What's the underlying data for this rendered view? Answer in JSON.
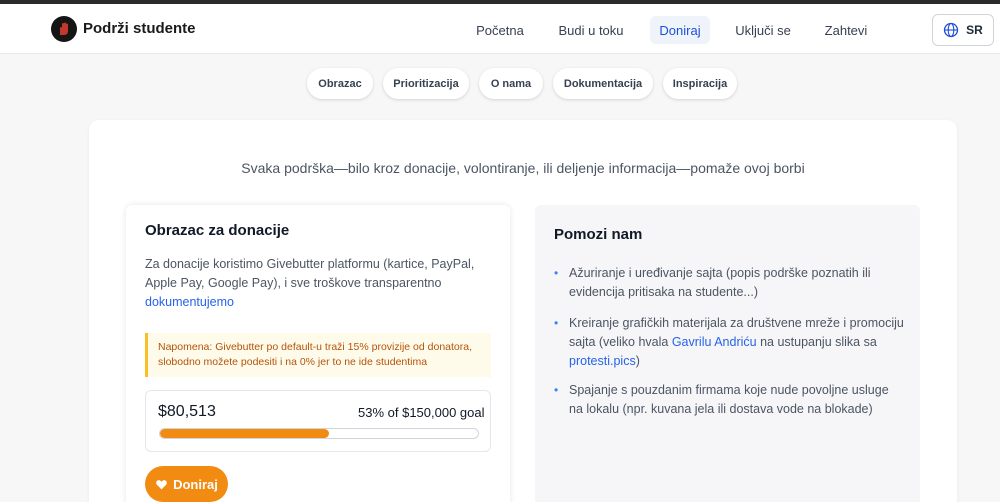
{
  "header": {
    "brand": "Podrži studente",
    "nav": [
      {
        "label": "Početna",
        "active": false
      },
      {
        "label": "Budi u toku",
        "active": false
      },
      {
        "label": "Doniraj",
        "active": true
      },
      {
        "label": "Uključi se",
        "active": false
      },
      {
        "label": "Zahtevi",
        "active": false
      }
    ],
    "language": "SR"
  },
  "subnav": [
    "Obrazac",
    "Prioritizacija",
    "O nama",
    "Dokumentacija",
    "Inspiracija"
  ],
  "tagline": "Svaka podrška—bilo kroz donacije, volontiranje, ili deljenje informacija—pomaže ovoj borbi",
  "donation_form": {
    "title": "Obrazac za donacije",
    "description": "Za donacije koristimo Givebutter platformu (kartice, PayPal, Apple Pay, Google Pay), i sve troškove transparentno",
    "description_link": "dokumentujemo",
    "note": "Napomena: Givebutter po default-u traži 15% provizije od donatora, slobodno možete podesiti i na 0% jer to ne ide studentima",
    "raised": "$80,513",
    "goal_text": "53% of $150,000 goal",
    "progress": 0.53,
    "donate_label": "Doniraj"
  },
  "help": {
    "title": "Pomozi nam",
    "items": [
      {
        "text": "Ažuriranje i uređivanje sajta (popis podrške poznatih ili evidencija pritisaka na studente...)"
      },
      {
        "text_a": "Kreiranje grafičkih materijala za društvene mreže i promociju sajta (veliko hvala ",
        "link_a": "Gavrilu Andriću",
        "text_b": " na ustupanju slika sa ",
        "link_b": "protesti.pics",
        "text_c": ")"
      },
      {
        "text": "Spajanje s pouzdanim firmama koje nude povoljne usluge na lokalu (npr. kuvana jela ili dostava vode na blokade)"
      }
    ]
  },
  "colors": {
    "accent": "#f28b12",
    "link": "#2563eb",
    "active_nav": "#1d4ed8"
  }
}
